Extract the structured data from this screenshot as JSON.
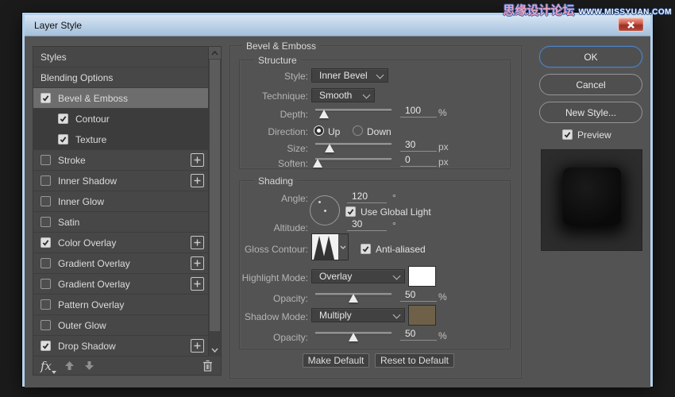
{
  "watermark": {
    "cn": "思缘设计论坛",
    "en": "WWW.MISSYUAN.COM"
  },
  "dialog": {
    "title": "Layer Style"
  },
  "sidebar": {
    "items": [
      {
        "label": "Styles",
        "type": "plain"
      },
      {
        "label": "Blending Options",
        "type": "plain"
      },
      {
        "label": "Bevel & Emboss",
        "type": "check",
        "checked": true,
        "selected": true
      },
      {
        "label": "Contour",
        "type": "check",
        "checked": true,
        "indent": true
      },
      {
        "label": "Texture",
        "type": "check",
        "checked": true,
        "indent": true
      },
      {
        "label": "Stroke",
        "type": "check",
        "checked": false,
        "plus": true
      },
      {
        "label": "Inner Shadow",
        "type": "check",
        "checked": false,
        "plus": true
      },
      {
        "label": "Inner Glow",
        "type": "check",
        "checked": false
      },
      {
        "label": "Satin",
        "type": "check",
        "checked": false
      },
      {
        "label": "Color Overlay",
        "type": "check",
        "checked": true,
        "plus": true
      },
      {
        "label": "Gradient Overlay",
        "type": "check",
        "checked": false,
        "plus": true
      },
      {
        "label": "Gradient Overlay",
        "type": "check",
        "checked": false,
        "plus": true
      },
      {
        "label": "Pattern Overlay",
        "type": "check",
        "checked": false
      },
      {
        "label": "Outer Glow",
        "type": "check",
        "checked": false
      },
      {
        "label": "Drop Shadow",
        "type": "check",
        "checked": true,
        "plus": true
      }
    ],
    "footer": {
      "fx_label": "fx"
    }
  },
  "main": {
    "section_title": "Bevel & Emboss",
    "structure": {
      "title": "Structure",
      "style_label": "Style:",
      "style_value": "Inner Bevel",
      "technique_label": "Technique:",
      "technique_value": "Smooth",
      "depth_label": "Depth:",
      "depth_value": "100",
      "depth_unit": "%",
      "direction_label": "Direction:",
      "direction_up": "Up",
      "direction_down": "Down",
      "size_label": "Size:",
      "size_value": "30",
      "size_unit": "px",
      "soften_label": "Soften:",
      "soften_value": "0",
      "soften_unit": "px"
    },
    "shading": {
      "title": "Shading",
      "angle_label": "Angle:",
      "angle_value": "120",
      "angle_unit": "°",
      "use_global_light_label": "Use Global Light",
      "altitude_label": "Altitude:",
      "altitude_value": "30",
      "altitude_unit": "°",
      "gloss_contour_label": "Gloss Contour:",
      "anti_aliased_label": "Anti-aliased",
      "highlight_mode_label": "Highlight Mode:",
      "highlight_mode_value": "Overlay",
      "highlight_color": "#ffffff",
      "highlight_opacity_label": "Opacity:",
      "highlight_opacity_value": "50",
      "highlight_opacity_unit": "%",
      "shadow_mode_label": "Shadow Mode:",
      "shadow_mode_value": "Multiply",
      "shadow_color": "#6f6149",
      "shadow_opacity_label": "Opacity:",
      "shadow_opacity_value": "50",
      "shadow_opacity_unit": "%"
    },
    "buttons": {
      "make_default": "Make Default",
      "reset_default": "Reset to Default"
    }
  },
  "right": {
    "ok_label": "OK",
    "cancel_label": "Cancel",
    "new_style_label": "New Style...",
    "preview_label": "Preview"
  },
  "sliders": {
    "depth_pct": 11,
    "size_pct": 19,
    "soften_pct": 3,
    "highlight_opacity_pct": 50,
    "shadow_opacity_pct": 50
  }
}
